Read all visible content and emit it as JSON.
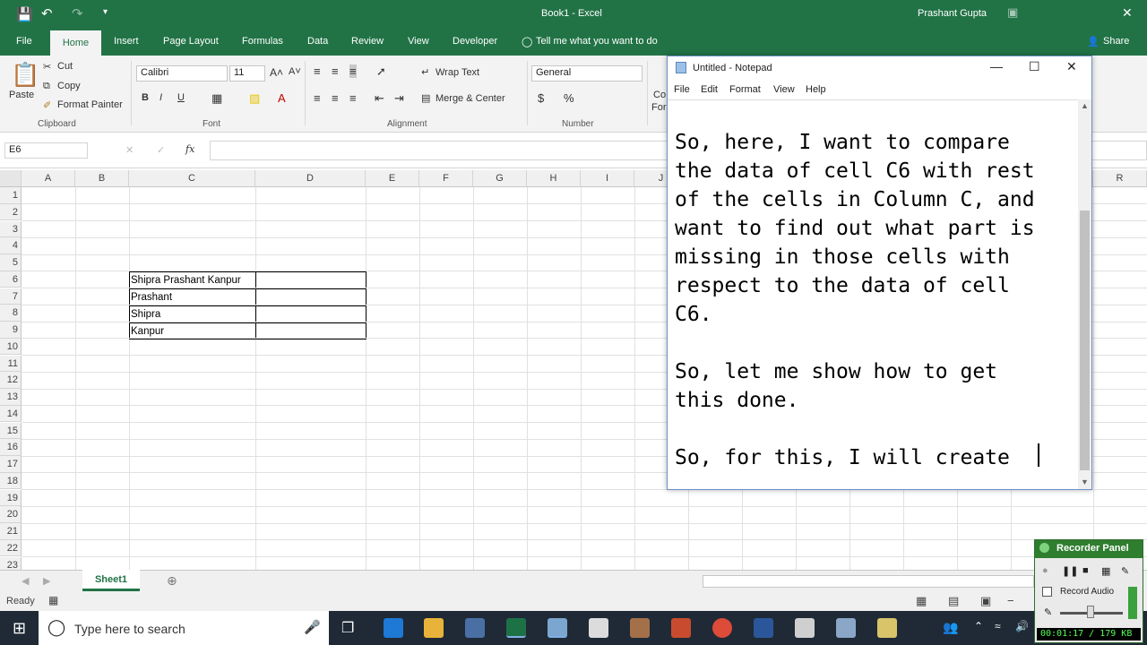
{
  "window_title": "Book1  -  Excel",
  "user_name": "Prashant Gupta",
  "ribbon_tabs": [
    "File",
    "Home",
    "Insert",
    "Page Layout",
    "Formulas",
    "Data",
    "Review",
    "View",
    "Developer"
  ],
  "tell_me": "Tell me what you want to do",
  "share_label": "Share",
  "clipboard": {
    "paste": "Paste",
    "cut": "Cut",
    "copy": "Copy",
    "format_painter": "Format Painter",
    "label": "Clipboard"
  },
  "font": {
    "name": "Calibri",
    "size": "11",
    "label": "Font"
  },
  "alignment": {
    "wrap_text": "Wrap Text",
    "merge_center": "Merge & Center",
    "label": "Alignment"
  },
  "number": {
    "format": "General",
    "label": "Number",
    "percent": "%",
    "currency": "$"
  },
  "styles_partial": {
    "line1": "Co",
    "line2": "For"
  },
  "name_box": "E6",
  "columns": [
    "A",
    "B",
    "C",
    "D",
    "E",
    "F",
    "G",
    "H",
    "I",
    "J",
    "R"
  ],
  "rows": [
    "1",
    "2",
    "3",
    "4",
    "5",
    "6",
    "7",
    "8",
    "9",
    "10",
    "11",
    "12",
    "13",
    "14",
    "15",
    "16",
    "17",
    "18",
    "19",
    "20",
    "21",
    "22",
    "23"
  ],
  "cells": {
    "C6": "Shipra Prashant Kanpur",
    "C7": "Prashant",
    "C8": "Shipra",
    "C9": "Kanpur"
  },
  "sheet_tab": "Sheet1",
  "status": "Ready",
  "taskbar": {
    "search_placeholder": "Type here to search"
  },
  "notepad": {
    "title": "Untitled - Notepad",
    "menu": [
      "File",
      "Edit",
      "Format",
      "View",
      "Help"
    ],
    "text": "So, here, I want to compare\nthe data of cell C6 with rest\nof the cells in Column C, and\nwant to find out what part is\nmissing in those cells with\nrespect to the data of cell\nC6.\n\nSo, let me show how to get\nthis done.\n\nSo, for this, I will create"
  },
  "recorder": {
    "title": "Recorder Panel",
    "record_audio": "Record Audio",
    "readout": "00:01:17 / 179 KB"
  },
  "colors": {
    "excel_green": "#217346",
    "taskbar": "#1f2a36",
    "notepad_border": "#6b8fc8"
  }
}
